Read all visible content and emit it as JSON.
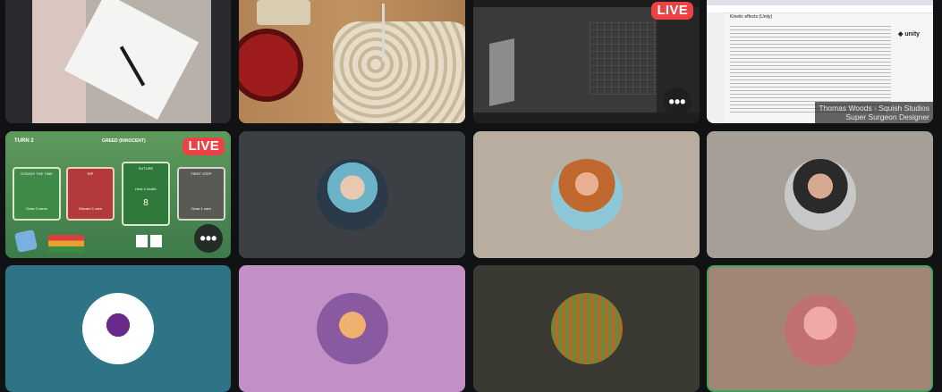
{
  "live_label": "LIVE",
  "more_glyph": "•••",
  "screen_share": {
    "presenter_name": "Thomas Woods - Squish Studios",
    "presenter_title": "Super Surgeon Designer",
    "wiki_heading": "Kinetic effects (Unity)"
  },
  "game": {
    "turn_label": "TURN 2",
    "greed_label": "GREED (INNOCENT)",
    "cards": [
      {
        "title": "STEADY THE TIME",
        "text": "Draw 2 cards"
      },
      {
        "title": "RIP",
        "text": "Discard 1 card"
      },
      {
        "title": "SUTURE",
        "text": "Heal 4 health"
      },
      {
        "title": "FIRST STEP",
        "text": "Draw 1 card"
      }
    ],
    "big_number": "8"
  },
  "colors": {
    "tile_dark": "#3c4045",
    "tile_beige": "#b8ad9e",
    "tile_teal": "#2e7386",
    "tile_lavender": "#c28fc6",
    "tile_olive": "#3a3a33",
    "tile_rose": "#a18678",
    "speaking_ring": "#3ba55d",
    "live_red": "#ed4245"
  }
}
